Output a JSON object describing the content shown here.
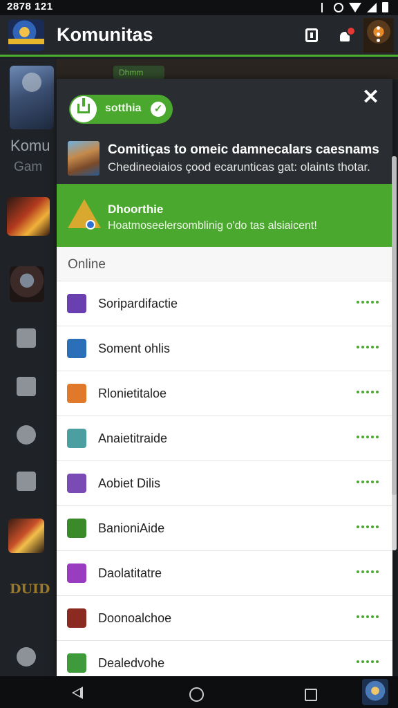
{
  "status_bar": {
    "time": "2878 121"
  },
  "app_bar": {
    "title": "Komunitas"
  },
  "background": {
    "side_text_1": "Komu",
    "side_text_2": "Gam",
    "tag_text": "Dhmm",
    "logo_text": "DUID"
  },
  "toast": {
    "label": "sotthia",
    "check": "✓"
  },
  "close_label": "✕",
  "message": {
    "title": "Comitiças to omeic damnecalars caesnams",
    "subtitle": "Chedineoiaios çood ecarunticas gat: olaints thotar."
  },
  "banner": {
    "title": "Dhoorthie",
    "subtitle": "Hoatmoseelersomblinig o'do tas alsiaicent!"
  },
  "section": {
    "title": "Online"
  },
  "online_list": [
    {
      "name": "Soripardifactie",
      "icon_color": "#6a3fb0"
    },
    {
      "name": "Soment ohlis",
      "icon_color": "#2a6fb8"
    },
    {
      "name": "Rlonietitaloe",
      "icon_color": "#e07a2a"
    },
    {
      "name": "Anaietitraide",
      "icon_color": "#4c9fa0"
    },
    {
      "name": "Aobiet Dilis",
      "icon_color": "#7a4bb5"
    },
    {
      "name": "BanioniAide",
      "icon_color": "#3a8a2a"
    },
    {
      "name": "Daolatitatre",
      "icon_color": "#9a3cc0"
    },
    {
      "name": "Doonoalchoe",
      "icon_color": "#8a2a20"
    },
    {
      "name": "Dealedvohe",
      "icon_color": "#3e9a3a"
    }
  ],
  "colors": {
    "accent": "#4aa82f",
    "panel_dark": "#2a2d31",
    "background": "#1d2024"
  },
  "nav": {
    "back": "back-icon",
    "home": "home-icon",
    "recents": "recents-icon"
  }
}
